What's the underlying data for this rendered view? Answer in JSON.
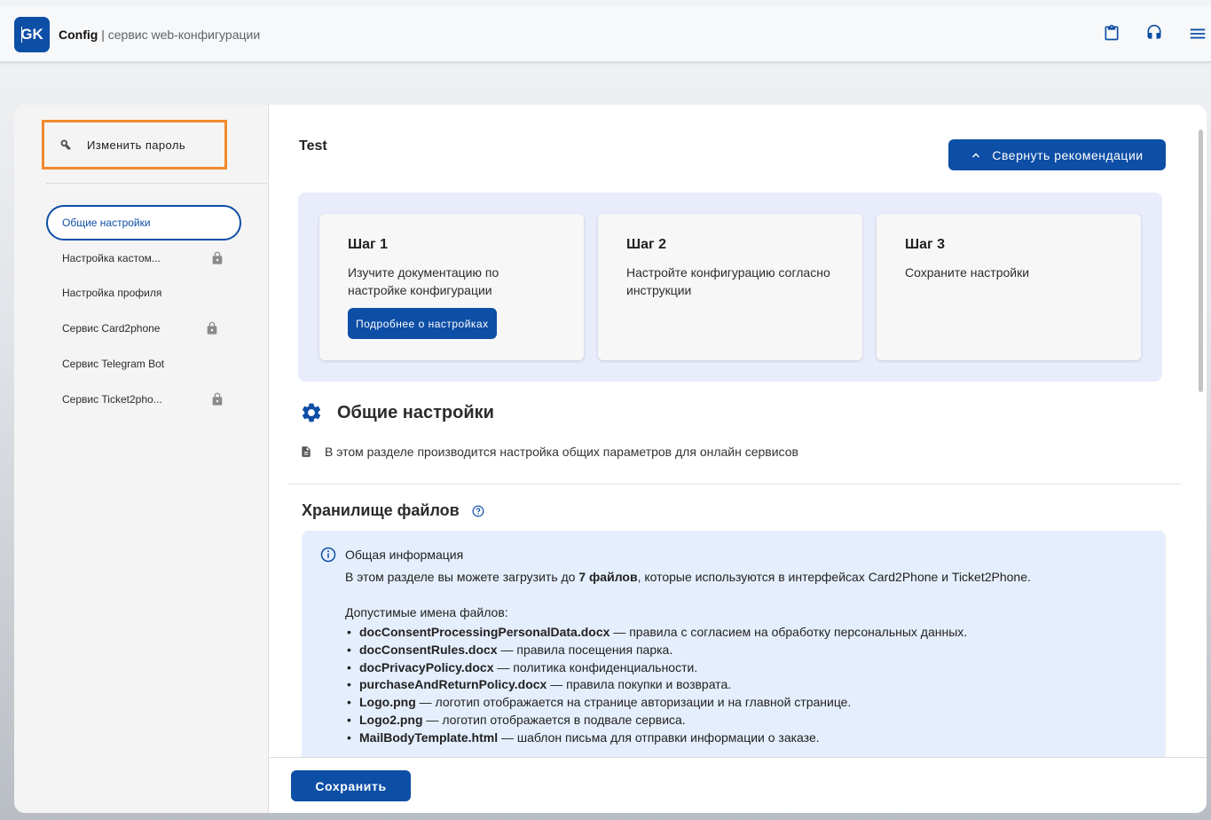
{
  "header": {
    "logo_text": "GK",
    "app_name": "Config",
    "separator": "|",
    "subtitle": "сервис web-конфигурации",
    "icons": [
      "clipboard-icon",
      "headset-icon",
      "menu-icon"
    ]
  },
  "sidebar": {
    "change_password": "Изменить пароль",
    "items": [
      {
        "label": "Общие настройки",
        "active": true,
        "locked": false
      },
      {
        "label": "Настройка кастом...",
        "active": false,
        "locked": true
      },
      {
        "label": "Настройка профиля",
        "active": false,
        "locked": false
      },
      {
        "label": "Сервис Card2phone",
        "active": false,
        "locked": true
      },
      {
        "label": "Сервис Telegram Bot",
        "active": false,
        "locked": false
      },
      {
        "label": "Сервис Ticket2pho...",
        "active": false,
        "locked": true
      }
    ]
  },
  "main": {
    "page_name": "Test",
    "collapse_button": "Свернуть рекомендации",
    "steps": [
      {
        "title": "Шаг 1",
        "text": "Изучите документацию по настройке конфигурации",
        "button": "Подробнее о настройках"
      },
      {
        "title": "Шаг 2",
        "text": "Настройте конфигурацию согласно инструкции"
      },
      {
        "title": "Шаг 3",
        "text": "Сохраните настройки"
      }
    ],
    "section_title": "Общие настройки",
    "section_desc": "В этом разделе производится настройка общих параметров для онлайн сервисов",
    "files_title": "Хранилище файлов",
    "info": {
      "heading": "Общая информация",
      "text_before": "В этом разделе вы можете загрузить до ",
      "text_bold": "7 файлов",
      "text_after": ", которые используются в интерфейсах Card2Phone и Ticket2Phone.",
      "allowed_label": "Допустимые имена файлов:",
      "files": [
        {
          "name": "docConsentProcessingPersonalData.docx",
          "desc": " — правила с согласием на обработку персональных данных."
        },
        {
          "name": "docConsentRules.docx",
          "desc": " — правила посещения парка."
        },
        {
          "name": "docPrivacyPolicy.docx",
          "desc": " — политика конфиденциальности."
        },
        {
          "name": "purchaseAndReturnPolicy.docx",
          "desc": " — правила покупки и возврата."
        },
        {
          "name": "Logo.png",
          "desc": " — логотип отображается на странице авторизации и на главной странице."
        },
        {
          "name": "Logo2.png",
          "desc": " — логотип отображается в подвале сервиса."
        },
        {
          "name": "MailBodyTemplate.html",
          "desc": " — шаблон письма для отправки информации о заказе."
        }
      ]
    },
    "save_button": "Сохранить"
  },
  "colors": {
    "primary": "#0d4ea6",
    "highlight": "#f08a2c",
    "steps_bg": "#e8ecfb",
    "info_bg": "#e5eefc"
  }
}
